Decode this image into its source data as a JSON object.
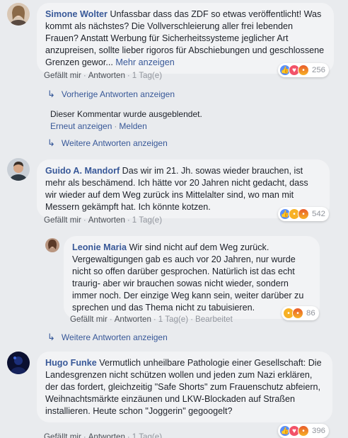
{
  "comments": [
    {
      "author": "Simone Wolter",
      "text": "Unfassbar dass das ZDF so etwas veröffentlicht! Was kommt als nächstes? Die Vollverschleierung aller frei lebenden Frauen? Anstatt Werbung für Sicherheitssysteme jeglicher Art anzupreisen, sollte lieber rigoros für Abschiebungen und geschlossene Grenzen gewor...",
      "more": "Mehr anzeigen",
      "like": "Gefällt mir",
      "reply": "Antworten",
      "time": "1 Tag(e)",
      "reaction_count": "256",
      "reactions": [
        "like-icon",
        "love-icon",
        "angry-icon"
      ]
    },
    {
      "author": "Guido A. Mandorf",
      "text": "Das wir im 21. Jh. sowas wieder brauchen, ist mehr als beschämend. Ich hätte vor 20 Jahren nicht gedacht, dass wir wieder auf dem Weg zurück ins Mittelalter sind, wo man mit Messern gekämpft hat. Ich könnte kotzen.",
      "like": "Gefällt mir",
      "reply": "Antworten",
      "time": "1 Tag(e)",
      "reaction_count": "542",
      "reactions": [
        "like-icon",
        "sad-icon",
        "angry-icon"
      ]
    },
    {
      "author": "Hugo Funke",
      "text": "Vermutlich unheilbare Pathologie einer Gesellschaft: Die Landesgrenzen nicht schützen wollen und jeden zum Nazi erklären, der das fordert, gleichzeitig \"Safe Shorts\" zum Frauenschutz abfeiern, Weihnachtsmärkte einzäunen und LKW-Blockaden auf Straßen installieren. Heute schon \"Joggerin\" gegoogelt?",
      "like": "Gefällt mir",
      "reply": "Antworten",
      "time": "1 Tag(e)",
      "reaction_count": "396",
      "reactions": [
        "like-icon",
        "love-icon",
        "angry-icon"
      ]
    }
  ],
  "reply": {
    "author": "Leonie Maria",
    "text": "Wir sind nicht auf dem Weg zurück. Vergewaltigungen gab es auch vor 20 Jahren, nur wurde nicht so offen darüber gesprochen. Natürlich ist das echt traurig- aber wir brauchen sowas nicht wieder, sondern immer noch. Der einzige Weg kann sein, weiter darüber zu sprechen und das Thema nicht zu tabuisieren.",
    "like": "Gefällt mir",
    "reply": "Antworten",
    "time": "1 Tag(e)",
    "edited": "Bearbeitet",
    "reaction_count": "86",
    "reactions": [
      "haha-icon",
      "angry-icon"
    ]
  },
  "thread1": {
    "previous": "Vorherige Antworten anzeigen",
    "hidden_text": "Dieser Kommentar wurde ausgeblendet.",
    "unhide": "Erneut anzeigen",
    "report": "Melden",
    "more_replies": "Weitere Antworten anzeigen"
  },
  "thread2": {
    "more_replies": "Weitere Antworten anzeigen"
  },
  "colors": {
    "background": "#e9ebee",
    "bubble": "#f2f3f5",
    "link": "#385898",
    "meta": "#90949c"
  }
}
